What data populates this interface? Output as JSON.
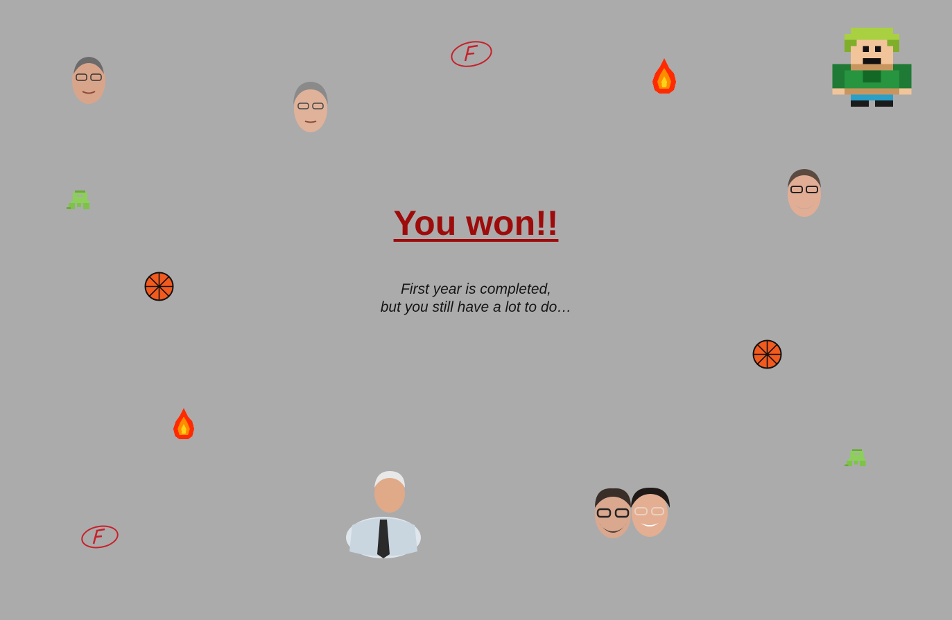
{
  "game": {
    "title": "You won!!",
    "message_line1": "First year is completed,",
    "message_line2": "but you still have a lot to do…"
  },
  "colors": {
    "background": "#ababab",
    "title": "#9e0b0b",
    "ball": "#f25a1e",
    "fire_outer": "#ff2a00",
    "fire_inner": "#ffd21a",
    "grade_ink": "#c8202a",
    "bug": "#7fc24a"
  },
  "sprites": {
    "player": "pixel-hero-sprite",
    "characters": [
      "professor-face",
      "professor-face",
      "professor-face",
      "professor-face",
      "professor-face",
      "professor-face"
    ],
    "hazards": [
      "fire-icon",
      "basketball-icon",
      "failed-grade-icon",
      "bug-icon"
    ]
  }
}
